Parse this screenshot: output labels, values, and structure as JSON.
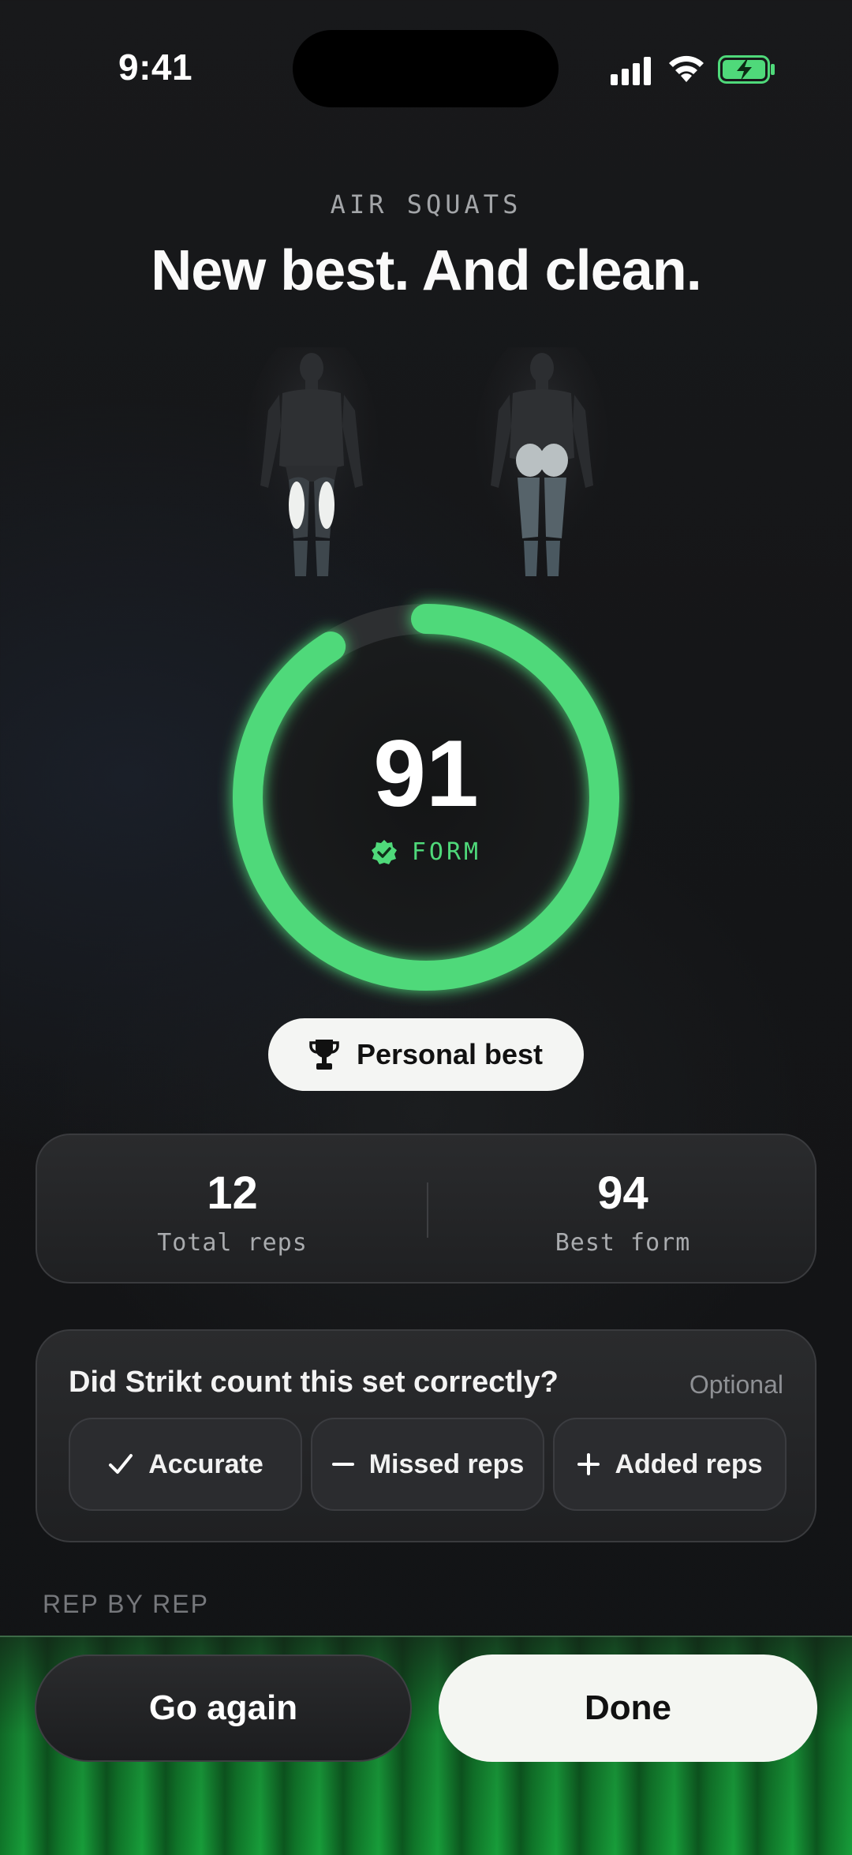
{
  "status_bar": {
    "time": "9:41"
  },
  "header": {
    "exercise": "AIR SQUATS",
    "headline": "New best. And clean."
  },
  "score": {
    "value": "91",
    "label": "FORM",
    "progress": 0.91,
    "color": "#4fd97a"
  },
  "badge": {
    "label": "Personal best",
    "icon": "trophy-icon"
  },
  "stats": [
    {
      "value": "12",
      "label": "Total reps"
    },
    {
      "value": "94",
      "label": "Best form"
    }
  ],
  "feedback": {
    "question": "Did Strikt count this set correctly?",
    "optional": "Optional",
    "options": [
      {
        "label": "Accurate",
        "icon": "check-icon"
      },
      {
        "label": "Missed reps",
        "icon": "minus-icon"
      },
      {
        "label": "Added reps",
        "icon": "plus-icon"
      }
    ]
  },
  "rep_section": {
    "title": "REP BY REP"
  },
  "actions": {
    "go_again": "Go again",
    "done": "Done"
  },
  "colors": {
    "accent": "#4fd97a",
    "background": "#141517"
  }
}
